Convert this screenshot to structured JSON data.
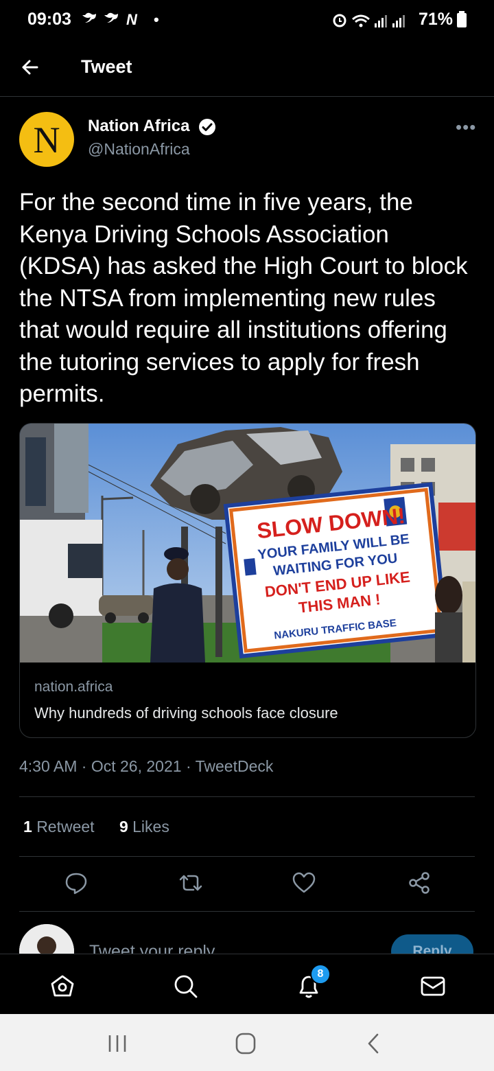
{
  "status_bar": {
    "time": "09:03",
    "notif_icons": "𝕪 𝕪 N •",
    "battery": "71%"
  },
  "header": {
    "title": "Tweet"
  },
  "author": {
    "initial": "N",
    "name": "Nation Africa",
    "handle": "@NationAfrica"
  },
  "tweet": {
    "text": "For the second time in five years, the Kenya Driving Schools Association (KDSA) has asked the High Court to block the NTSA from implementing new rules that would require all institutions offering the tutoring services to apply for fresh permits."
  },
  "card": {
    "sign_lines": [
      "SLOW DOWN!",
      "YOUR FAMILY WILL BE",
      "WAITING FOR YOU",
      "DON'T END UP LIKE",
      "THIS MAN !",
      "NAKURU  TRAFFIC  BASE"
    ],
    "domain": "nation.africa",
    "title": "Why hundreds of driving schools face closure"
  },
  "meta": {
    "time": "4:30 AM",
    "date": "Oct 26, 2021",
    "source": "TweetDeck",
    "dot": "·"
  },
  "stats": {
    "retweets_count": "1",
    "retweets_label": "Retweet",
    "likes_count": "9",
    "likes_label": "Likes"
  },
  "reply": {
    "placeholder": "Tweet your reply",
    "button": "Reply"
  },
  "bottom_nav": {
    "notifications_badge": "8"
  },
  "colors": {
    "accent": "#1d9bf0",
    "background": "#000000",
    "secondary_text": "#8b98a5",
    "avatar_yellow": "#f4be12"
  }
}
